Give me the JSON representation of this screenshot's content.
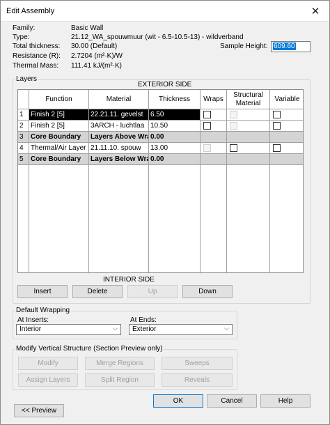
{
  "window": {
    "title": "Edit Assembly",
    "close_glyph": "✕"
  },
  "properties": {
    "family_label": "Family:",
    "family_value": "Basic Wall",
    "type_label": "Type:",
    "type_value": "21.12_WA_spouwmuur (wit - 6.5-10.5-13) - wildverband",
    "thickness_label": "Total thickness:",
    "thickness_value": "30.00 (Default)",
    "resistance_label": "Resistance (R):",
    "resistance_value": "2.7204 (m²·K)/W",
    "mass_label": "Thermal Mass:",
    "mass_value": "111.41 kJ/(m²·K)"
  },
  "sample_height": {
    "label": "Sample Height:",
    "value": "609.60"
  },
  "layers": {
    "group_label": "Layers",
    "exterior_label": "EXTERIOR SIDE",
    "interior_label": "INTERIOR SIDE",
    "columns": [
      "Function",
      "Material",
      "Thickness",
      "Wraps",
      "Structural Material",
      "Variable"
    ],
    "rows": [
      {
        "num": "1",
        "function": "Finish 2 [5]",
        "material": "22.21.11. gevelst",
        "thickness": "6.50",
        "selected": true,
        "bold": false
      },
      {
        "num": "2",
        "function": "Finish 2 [5]",
        "material": "3ARCH - luchtlaa",
        "thickness": "10.50",
        "selected": false,
        "bold": false
      },
      {
        "num": "3",
        "function": "Core Boundary",
        "material": "Layers Above Wra",
        "thickness": "0.00",
        "selected": false,
        "bold": true
      },
      {
        "num": "4",
        "function": "Thermal/Air Layer [",
        "material": "21.11.10. spouw",
        "thickness": "13.00",
        "selected": false,
        "bold": false
      },
      {
        "num": "5",
        "function": "Core Boundary",
        "material": "Layers Below Wra",
        "thickness": "0.00",
        "selected": false,
        "bold": true
      }
    ],
    "buttons": {
      "insert": "Insert",
      "delete": "Delete",
      "up": "Up",
      "down": "Down"
    }
  },
  "wrapping": {
    "group_label": "Default Wrapping",
    "inserts_label": "At Inserts:",
    "inserts_value": "Interior",
    "ends_label": "At Ends:",
    "ends_value": "Exterior"
  },
  "vertical": {
    "group_label": "Modify Vertical Structure (Section Preview only)",
    "modify": "Modify",
    "merge": "Merge Regions",
    "sweeps": "Sweeps",
    "assign": "Assign Layers",
    "split": "Split Region",
    "reveals": "Reveals"
  },
  "footer": {
    "preview": "<< Preview",
    "ok": "OK",
    "cancel": "Cancel",
    "help": "Help"
  },
  "colors": {
    "selected_row": "#000000",
    "core_row": "#d4d4d4",
    "accent": "#0078d7"
  }
}
